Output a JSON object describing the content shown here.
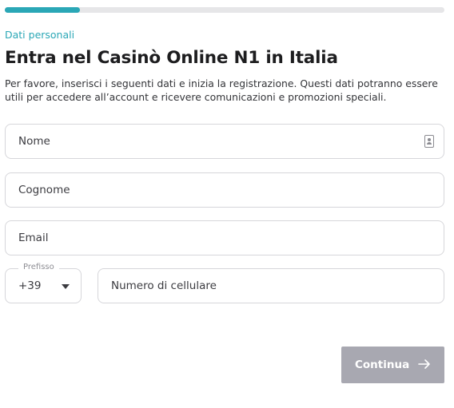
{
  "progress": {
    "value": 0.17,
    "color": "#2aa7b6"
  },
  "step_label": "Dati personali",
  "title": "Entra nel Casinò Online N1 in Italia",
  "description": "Per favore, inserisci i seguenti dati e inizia la registrazione. Questi dati potranno essere utili per accedere all’account e ricevere comunicazioni e promozioni speciali.",
  "form": {
    "first_name": {
      "placeholder": "Nome",
      "icon": "contact-card-icon"
    },
    "last_name": {
      "placeholder": "Cognome"
    },
    "email": {
      "placeholder": "Email"
    },
    "prefix": {
      "label": "Prefisso",
      "value": "+39",
      "icon": "chevron-down-icon"
    },
    "phone": {
      "placeholder": "Numero di cellulare"
    }
  },
  "continue_button": {
    "label": "Continua",
    "icon": "arrow-right-icon",
    "color": "#a8a8b1"
  }
}
